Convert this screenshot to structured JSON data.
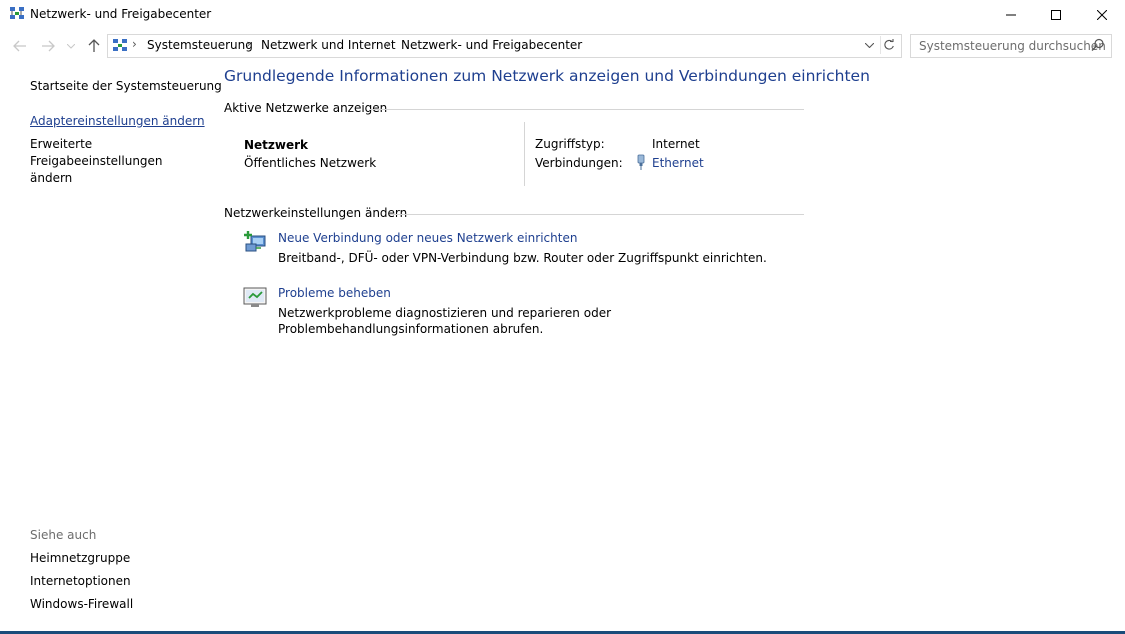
{
  "window": {
    "title": "Netzwerk- und Freigabecenter",
    "minimize_label": "—",
    "maximize_label": "☐",
    "close_label": "✕"
  },
  "navigation": {
    "breadcrumbs": [
      "Systemsteuerung",
      "Netzwerk und Internet",
      "Netzwerk- und Freigabecenter"
    ],
    "search_placeholder": "Systemsteuerung durchsuchen"
  },
  "left_pane": {
    "links": [
      {
        "label": "Startseite der Systemsteuerung"
      },
      {
        "label": "Adaptereinstellungen ändern"
      },
      {
        "label": "Erweiterte Freigabeeinstellungen ändern"
      }
    ],
    "see_also_title": "Siehe auch",
    "see_also": [
      {
        "label": "Heimnetzgruppe"
      },
      {
        "label": "Internetoptionen"
      },
      {
        "label": "Windows-Firewall"
      }
    ]
  },
  "main": {
    "title": "Grundlegende Informationen zum Netzwerk anzeigen und Verbindungen einrichten",
    "active_networks_heading": "Aktive Netzwerke anzeigen",
    "network": {
      "name": "Netzwerk",
      "category": "Öffentliches Netzwerk",
      "access_type_label": "Zugriffstyp:",
      "access_type_value": "Internet",
      "connections_label": "Verbindungen:",
      "connection_name": "Ethernet"
    },
    "settings_heading": "Netzwerkeinstellungen ändern",
    "tasks": [
      {
        "title": "Neue Verbindung oder neues Netzwerk einrichten",
        "description": "Breitband-, DFÜ- oder VPN-Verbindung bzw. Router oder Zugriffspunkt einrichten."
      },
      {
        "title": "Probleme beheben",
        "description": "Netzwerkprobleme diagnostizieren und reparieren oder Problembehandlungsinformationen abrufen."
      }
    ]
  },
  "colors": {
    "link": "#1e3f8f",
    "divider": "#d5d5d5",
    "muted": "#6d6d6d"
  },
  "icons": {
    "app": "network-sharing-icon",
    "back": "arrow-left-icon",
    "forward": "arrow-right-icon",
    "up": "arrow-up-icon",
    "refresh": "refresh-icon",
    "search": "search-icon",
    "ethernet": "ethernet-icon",
    "new_connection": "new-connection-icon",
    "troubleshoot": "troubleshoot-icon"
  }
}
